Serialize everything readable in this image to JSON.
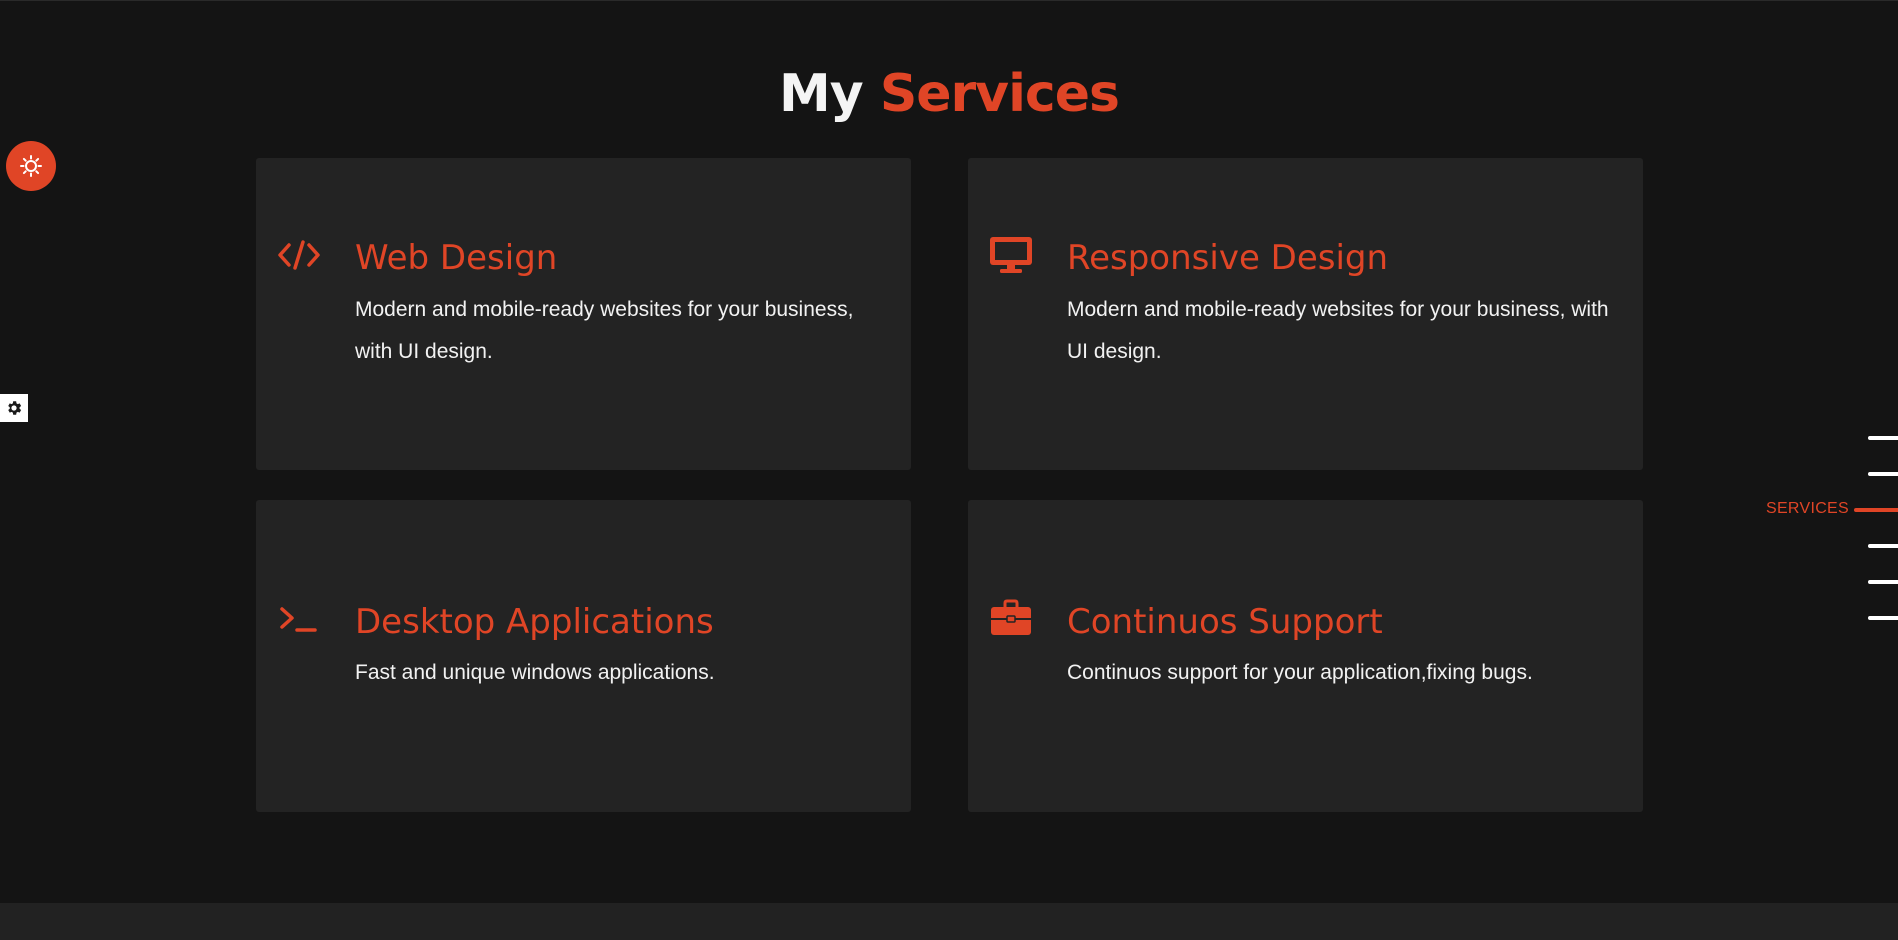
{
  "section": {
    "title_part1": "My",
    "title_part2": "Services"
  },
  "services": [
    {
      "icon": "code-icon",
      "title": "Web Design",
      "description": "Modern and mobile-ready websites for your business, with UI design."
    },
    {
      "icon": "desktop-monitor-icon",
      "title": "Responsive Design",
      "description": "Modern and mobile-ready websites for your business, with UI design."
    },
    {
      "icon": "terminal-icon",
      "title": "Desktop Applications",
      "description": "Fast and unique windows applications."
    },
    {
      "icon": "briefcase-icon",
      "title": "Continuos Support",
      "description": "Continuos support for your application,fixing bugs."
    }
  ],
  "controls": {
    "theme_toggle_icon": "sun-icon",
    "settings_icon": "gear-icon"
  },
  "side_nav": {
    "active_label": "SERVICES",
    "item_count": 6,
    "active_index": 2
  },
  "colors": {
    "accent": "#e04526",
    "background": "#141414",
    "card": "#232323"
  }
}
